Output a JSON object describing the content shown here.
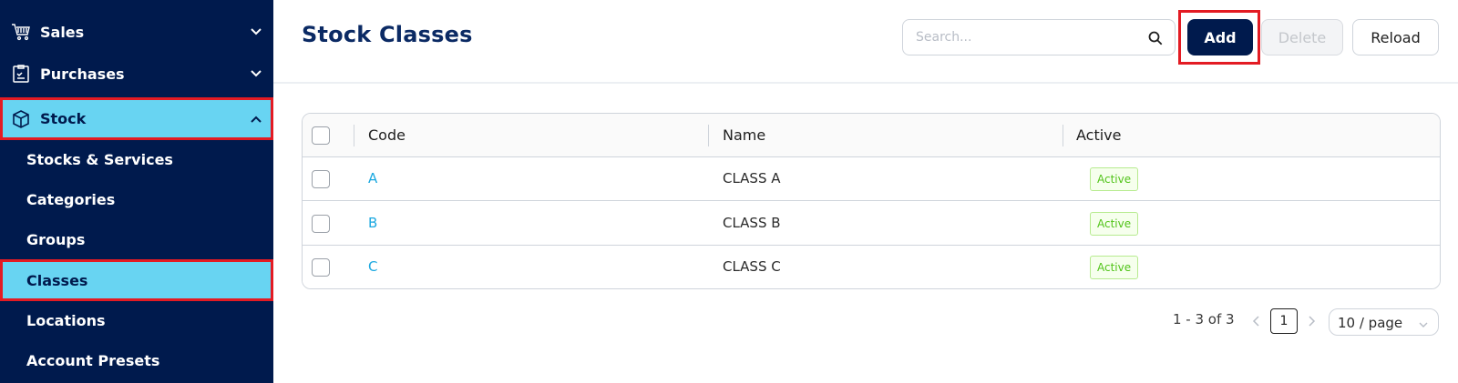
{
  "sidebar": {
    "groups": [
      {
        "label": "Sales",
        "icon": "cart-icon",
        "chevron": "chevron-down-icon"
      },
      {
        "label": "Purchases",
        "icon": "clipboard-icon",
        "chevron": "chevron-down-icon"
      },
      {
        "label": "Stock",
        "icon": "box-icon",
        "chevron": "chevron-up-icon",
        "active": true
      }
    ],
    "stock_items": [
      {
        "label": "Stocks & Services"
      },
      {
        "label": "Categories"
      },
      {
        "label": "Groups"
      },
      {
        "label": "Classes",
        "active": true
      },
      {
        "label": "Locations"
      },
      {
        "label": "Account Presets"
      }
    ]
  },
  "header": {
    "title": "Stock Classes",
    "search": {
      "placeholder": "Search...",
      "value": ""
    },
    "buttons": {
      "add": "Add",
      "delete": "Delete",
      "reload": "Reload"
    }
  },
  "table": {
    "columns": [
      "Code",
      "Name",
      "Active"
    ],
    "rows": [
      {
        "code": "A",
        "name": "CLASS A",
        "status": "Active"
      },
      {
        "code": "B",
        "name": "CLASS B",
        "status": "Active"
      },
      {
        "code": "C",
        "name": "CLASS C",
        "status": "Active"
      }
    ]
  },
  "pagination": {
    "total_text": "1 - 3 of 3",
    "current_page": "1",
    "page_size": "10 / page"
  },
  "colors": {
    "sidebar_bg": "#001a4d",
    "active_bg": "#68d4f2",
    "highlight_border": "#e31b23",
    "title": "#0b2a64",
    "link": "#1ba8e0",
    "badge_text": "#52c41a"
  }
}
